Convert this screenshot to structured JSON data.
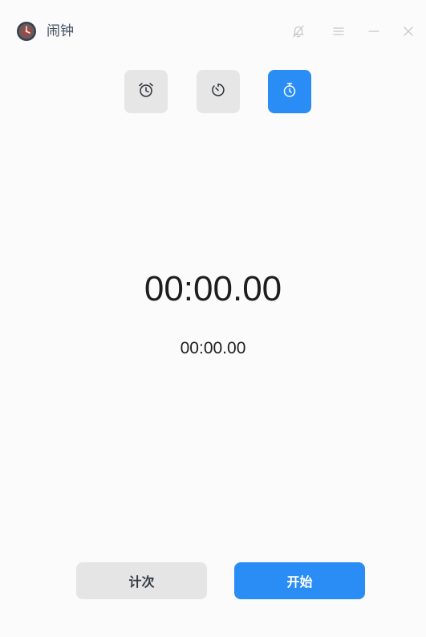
{
  "window": {
    "title": "闹钟"
  },
  "titlebar": {
    "icons": [
      "clock-app-icon",
      "bell-mute-icon",
      "menu-icon",
      "minimize-icon",
      "close-icon"
    ]
  },
  "modes": [
    {
      "icon": "alarm-clock-icon",
      "active": false
    },
    {
      "icon": "timer-icon",
      "active": false
    },
    {
      "icon": "stopwatch-icon",
      "active": true
    }
  ],
  "stopwatch": {
    "total_time": "00:00.00",
    "lap_time": "00:00.00"
  },
  "actions": {
    "lap_label": "计次",
    "start_label": "开始"
  },
  "colors": {
    "accent": "#2a8cf5",
    "button_gray": "#e5e5e5",
    "background": "#fbfbfb"
  }
}
